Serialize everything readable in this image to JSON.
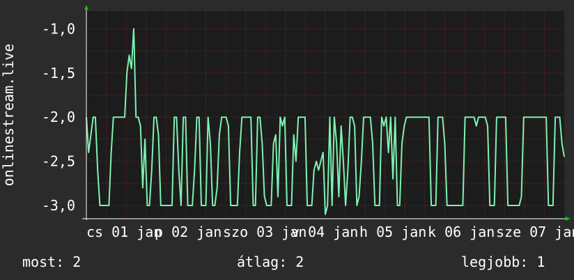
{
  "chart_data": {
    "type": "line",
    "ylabel": "onlinestream.live",
    "ylim": [
      -3.15,
      -0.8
    ],
    "yticks": [
      -1.0,
      -1.5,
      -2.0,
      -2.5,
      -3.0
    ],
    "ytick_labels": [
      "-1,0",
      "-1,5",
      "-2,0",
      "-2,5",
      "-3,0"
    ],
    "xticks": [
      "cs 01 jan",
      "p 02 jan",
      "szo 03 jan",
      "v 04 jan",
      "h 05 jan",
      "k 06 jan",
      "sze 07 jan"
    ],
    "grid": true,
    "colors": {
      "background": "#2b2b2b",
      "plot": "#1c1c1c",
      "grid": "#7a2a2a",
      "line": "#7ef2b0",
      "axis": "#ffffff",
      "arrow": "#00cc00"
    },
    "series": [
      {
        "values": [
          -2.0,
          -2.4,
          -2.2,
          -2.0,
          -2.0,
          -2.6,
          -3.0,
          -3.0,
          -3.0,
          -3.0,
          -3.0,
          -2.4,
          -2.0,
          -2.0,
          -2.0,
          -2.0,
          -2.0,
          -2.0,
          -1.5,
          -1.3,
          -1.45,
          -1.0,
          -2.0,
          -2.0,
          -2.1,
          -2.8,
          -2.25,
          -3.0,
          -3.0,
          -2.6,
          -2.0,
          -2.0,
          -2.2,
          -3.0,
          -3.0,
          -3.0,
          -3.0,
          -3.0,
          -3.0,
          -2.0,
          -2.0,
          -2.6,
          -3.0,
          -2.0,
          -2.0,
          -3.0,
          -3.0,
          -3.0,
          -2.6,
          -2.0,
          -2.0,
          -3.0,
          -3.0,
          -3.0,
          -2.0,
          -2.3,
          -3.0,
          -3.0,
          -2.8,
          -2.2,
          -2.0,
          -2.0,
          -2.0,
          -2.1,
          -3.0,
          -3.0,
          -3.0,
          -3.0,
          -2.4,
          -2.0,
          -2.0,
          -2.0,
          -2.0,
          -2.0,
          -3.0,
          -3.0,
          -2.0,
          -2.0,
          -2.3,
          -2.9,
          -3.0,
          -3.0,
          -3.0,
          -2.3,
          -2.2,
          -2.9,
          -2.0,
          -2.1,
          -2.0,
          -3.0,
          -3.0,
          -3.0,
          -2.2,
          -2.5,
          -2.0,
          -2.0,
          -2.0,
          -2.0,
          -3.0,
          -3.0,
          -3.0,
          -2.6,
          -2.5,
          -2.6,
          -2.5,
          -2.4,
          -3.1,
          -3.0,
          -2.0,
          -3.0,
          -2.0,
          -2.3,
          -2.9,
          -2.1,
          -2.5,
          -3.0,
          -2.6,
          -2.0,
          -2.0,
          -2.1,
          -3.0,
          -2.9,
          -2.5,
          -2.0,
          -2.0,
          -2.0,
          -2.0,
          -2.3,
          -3.0,
          -3.0,
          -3.0,
          -2.0,
          -2.1,
          -2.0,
          -2.4,
          -2.0,
          -2.7,
          -2.0,
          -3.0,
          -3.0,
          -2.3,
          -2.1,
          -2.0,
          -2.0,
          -2.0,
          -2.0,
          -2.0,
          -2.0,
          -2.0,
          -2.0,
          -2.0,
          -2.0,
          -2.0,
          -3.0,
          -3.0,
          -3.0,
          -2.0,
          -2.0,
          -2.0,
          -2.3,
          -3.0,
          -3.0,
          -3.0,
          -3.0,
          -3.0,
          -3.0,
          -3.0,
          -3.0,
          -2.0,
          -2.0,
          -2.0,
          -2.0,
          -2.0,
          -2.1,
          -2.0,
          -2.0,
          -2.0,
          -2.0,
          -2.1,
          -3.0,
          -3.0,
          -3.0,
          -2.0,
          -2.0,
          -2.0,
          -2.0,
          -2.0,
          -3.0,
          -3.0,
          -3.0,
          -3.0,
          -3.0,
          -3.0,
          -2.9,
          -2.0,
          -2.0,
          -2.0,
          -2.0,
          -2.0,
          -2.0,
          -2.0,
          -2.0,
          -2.0,
          -2.0,
          -2.0,
          -3.0,
          -3.0,
          -3.0,
          -2.0,
          -2.0,
          -2.0,
          -2.3,
          -2.45
        ]
      }
    ]
  },
  "stats": {
    "current": "most: 2",
    "average": "átlag: 2",
    "max": "legjobb: 1"
  }
}
